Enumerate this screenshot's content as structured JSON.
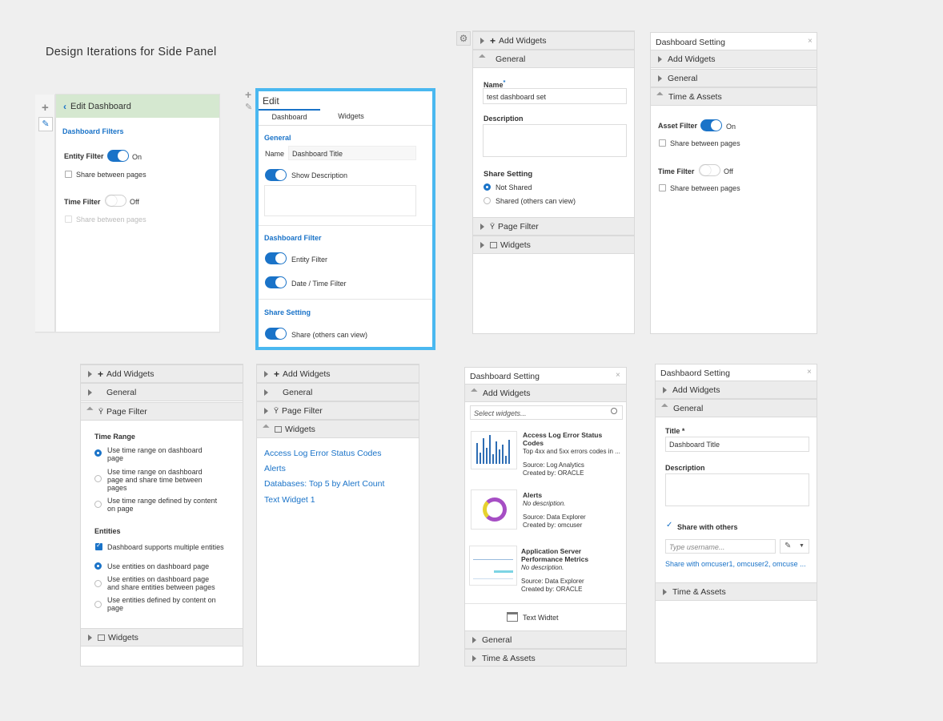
{
  "page_title": "Design Iterations for Side Panel",
  "p1": {
    "header": "Edit Dashboard",
    "filters_heading": "Dashboard Filters",
    "entity_filter": "Entity Filter",
    "entity_state": "On",
    "share1": "Share between pages",
    "time_filter": "Time Filter",
    "time_state": "Off",
    "share2": "Share between pages"
  },
  "p2": {
    "title": "Edit",
    "tab_dashboard": "Dashboard",
    "tab_widgets": "Widgets",
    "general": "General",
    "name_label": "Name",
    "name_value": "Dashboard Title",
    "show_desc": "Show Description",
    "dashboard_filter": "Dashboard Filter",
    "entity_filter": "Entity Filter",
    "date_filter": "Date / Time Filter",
    "share_setting": "Share Setting",
    "share_label": "Share (others can view)"
  },
  "p3": {
    "add_widgets": "Add Widgets",
    "general": "General",
    "name_label": "Name",
    "name_value": "test dashboard set",
    "description": "Description",
    "share_setting": "Share Setting",
    "not_shared": "Not Shared",
    "shared": "Shared (others can view)",
    "page_filter": "Page Filter",
    "widgets": "Widgets"
  },
  "p4": {
    "title": "Dashboard Setting",
    "add_widgets": "Add Widgets",
    "general": "General",
    "time_assets": "Time & Assets",
    "asset_filter": "Asset Filter",
    "asset_state": "On",
    "share1": "Share between pages",
    "time_filter": "Time Filter",
    "time_state": "Off",
    "share2": "Share between pages"
  },
  "p5": {
    "add_widgets": "Add Widgets",
    "general": "General",
    "page_filter": "Page Filter",
    "time_range": "Time Range",
    "tr1a": "Use time range on dashboard",
    "tr1b": "page",
    "tr2a": "Use time range on dashboard",
    "tr2b": "page and share time between",
    "tr2c": "pages",
    "tr3a": "Use time range defined by content",
    "tr3b": "on page",
    "entities": "Entities",
    "multi": "Dashboard supports multiple entities",
    "e1": "Use entities on dashboard page",
    "e2a": "Use entities on dashboard page",
    "e2b": "and share entities between pages",
    "e3a": "Use entities defined by content on",
    "e3b": "page",
    "widgets": "Widgets"
  },
  "p6": {
    "add_widgets": "Add Widgets",
    "general": "General",
    "page_filter": "Page Filter",
    "widgets": "Widgets",
    "links": [
      "Access Log Error Status Codes",
      "Alerts",
      "Databases: Top 5 by Alert Count",
      "Text Widget 1"
    ]
  },
  "p7": {
    "title": "Dashboard Setting",
    "add_widgets": "Add Widgets",
    "search_placeholder": "Select widgets...",
    "w1_title_a": "Access Log Error Status",
    "w1_title_b": "Codes",
    "w1_desc": "Top 4xx and 5xx errors codes in ...",
    "w1_source": "Source: Log Analytics",
    "w1_created": "Created by: ORACLE",
    "w2_title": "Alerts",
    "w2_desc": "No description.",
    "w2_source": "Source: Data Explorer",
    "w2_created": "Created by: omcuser",
    "w3_title_a": "Application Server",
    "w3_title_b": "Performance Metrics",
    "w3_desc": "No description.",
    "w3_source": "Source: Data Explorer",
    "w3_created": "Created by: ORACLE",
    "text_widget": "Text Widtet",
    "general": "General",
    "time_assets": "Time & Assets"
  },
  "p8": {
    "title": "Dashbaord Setting",
    "add_widgets": "Add Widgets",
    "general": "General",
    "title_label": "Title *",
    "title_value": "Dashboard Title",
    "description": "Description",
    "share_with": "Share with others",
    "user_placeholder": "Type username...",
    "share_list": "Share with omcuser1, omcuser2, omcuse ...",
    "time_assets": "Time & Assets"
  },
  "colors": {
    "accent": "#1a73c8",
    "highlight_border": "#4ab8f0",
    "header_green": "#d5e8d0"
  }
}
